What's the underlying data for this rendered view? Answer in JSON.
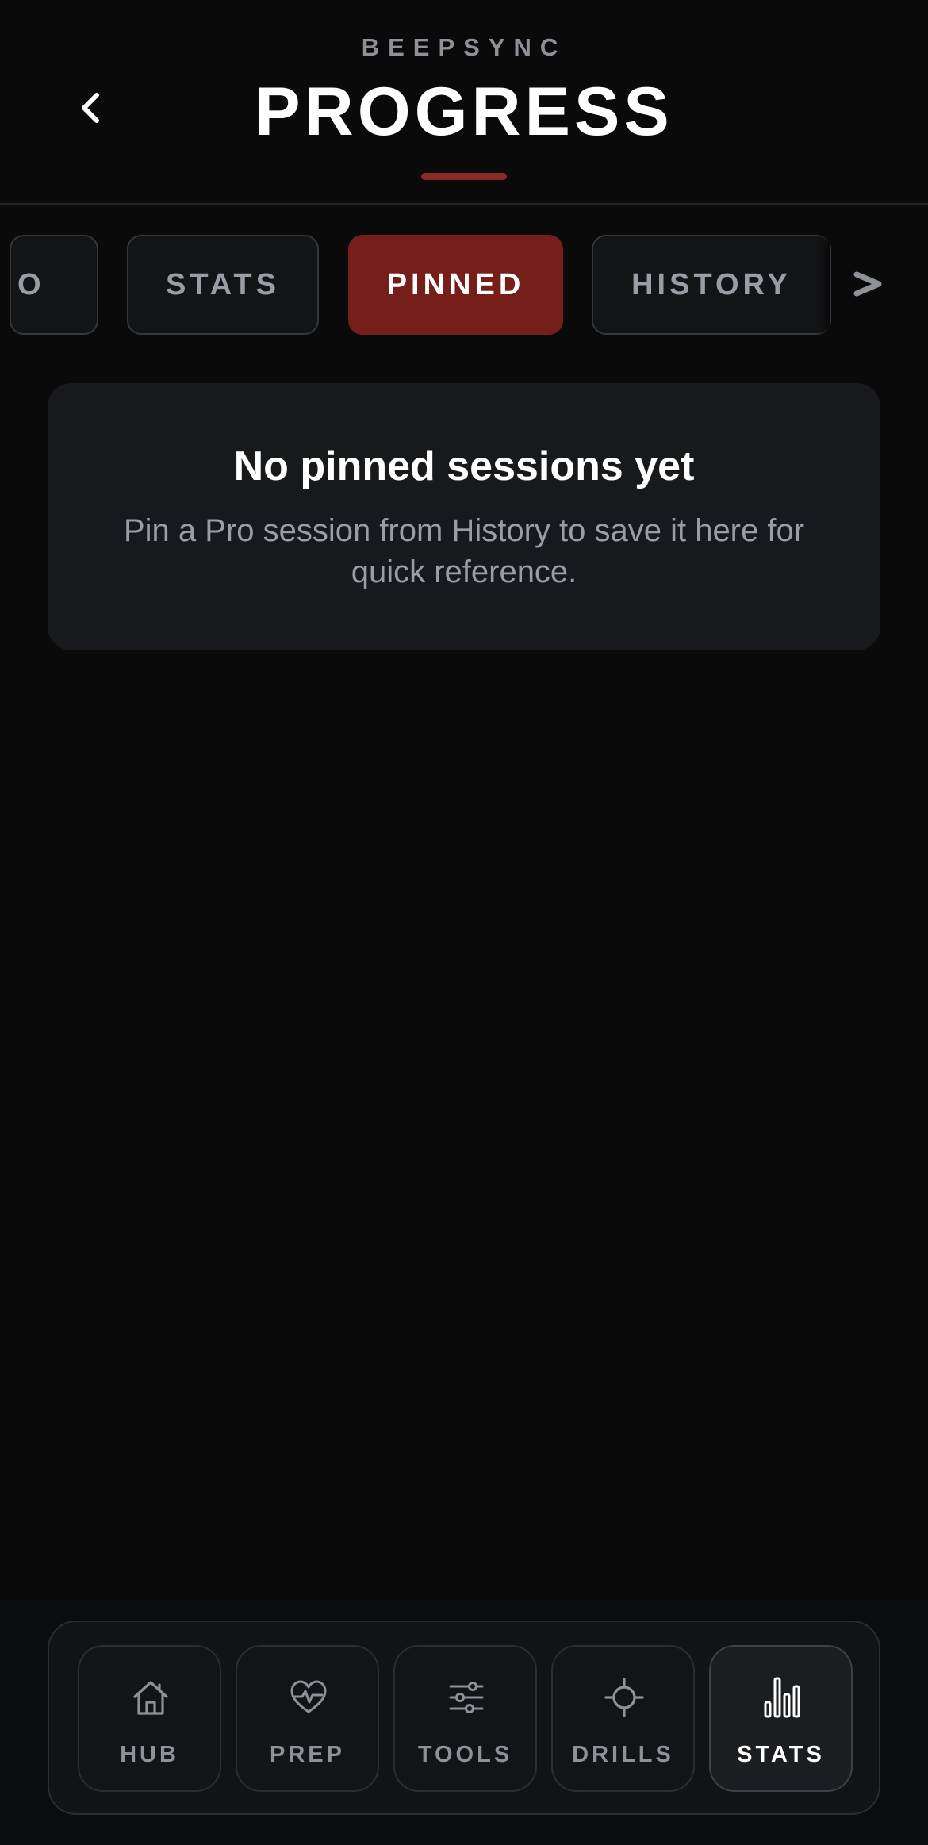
{
  "header": {
    "brand": "BEEPSYNC",
    "title": "PROGRESS",
    "back_icon": "chevron-left-icon",
    "underline_color": "#8b2a23"
  },
  "tabs": {
    "items": [
      {
        "label": "O",
        "state": "partially-scrolled-out"
      },
      {
        "label": "STATS"
      },
      {
        "label": "PINNED",
        "active": true
      },
      {
        "label": "HISTORY"
      }
    ],
    "next_icon": "chevron-right-icon",
    "active_color": "#761e19"
  },
  "empty_state": {
    "title": "No pinned sessions yet",
    "message": "Pin a Pro session from History to save it here for quick reference."
  },
  "bottom_nav": {
    "items": [
      {
        "label": "HUB",
        "icon": "home-icon"
      },
      {
        "label": "PREP",
        "icon": "heart-pulse-icon"
      },
      {
        "label": "TOOLS",
        "icon": "sliders-icon"
      },
      {
        "label": "DRILLS",
        "icon": "crosshair-icon"
      },
      {
        "label": "STATS",
        "icon": "bar-chart-icon",
        "active": true
      }
    ]
  }
}
